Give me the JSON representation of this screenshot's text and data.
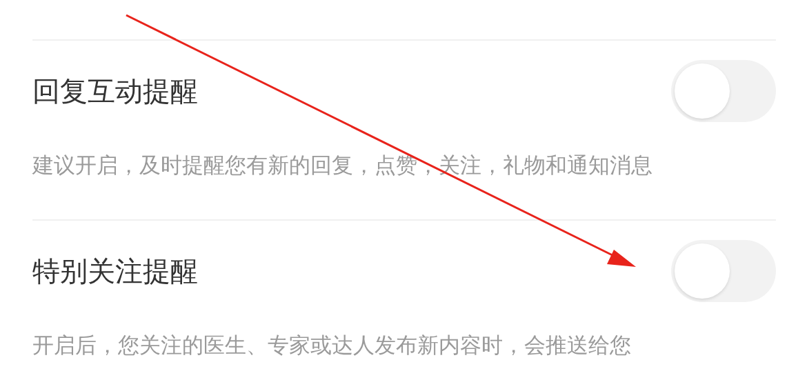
{
  "settings": [
    {
      "title": "回复互动提醒",
      "on": false,
      "description": "建议开启，及时提醒您有新的回复，点赞，关注，礼物和通知消息"
    },
    {
      "title": "特别关注提醒",
      "on": false,
      "description": "开启后，您关注的医生、专家或达人发布新内容时，会推送给您"
    }
  ],
  "annotation": {
    "kind": "arrow"
  }
}
